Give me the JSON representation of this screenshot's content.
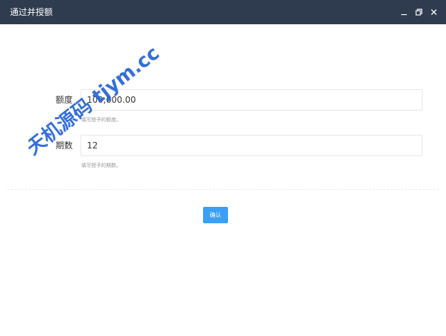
{
  "window": {
    "title": "通过并授额"
  },
  "form": {
    "amount": {
      "label": "额度",
      "value": "100,000.00",
      "hint": "填写授予的额度。"
    },
    "term": {
      "label": "期数",
      "value": "12",
      "hint": "填写授予的期数。"
    },
    "confirm_label": "确认"
  },
  "watermark": {
    "text": "天机源码 tjym.cc",
    "color": "#1f5fd6"
  },
  "colors": {
    "titlebar": "#2f3c4f",
    "accent": "#3a9ff5"
  },
  "icons": {
    "minimize": "minimize-icon",
    "restore": "restore-icon",
    "close": "close-icon"
  }
}
